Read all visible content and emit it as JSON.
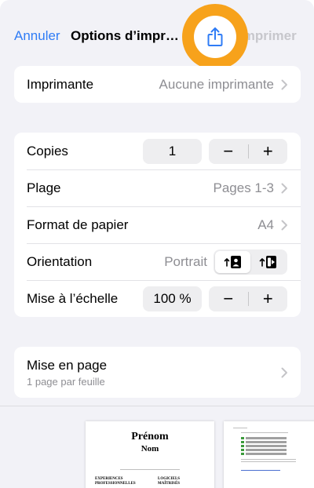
{
  "nav": {
    "cancel": "Annuler",
    "title": "Options d’impr…",
    "print": "Imprimer",
    "share_icon": "share-icon"
  },
  "printer": {
    "label": "Imprimante",
    "value": "Aucune imprimante"
  },
  "settings": {
    "copies": {
      "label": "Copies",
      "value": "1",
      "minus": "−",
      "plus": "+"
    },
    "range": {
      "label": "Plage",
      "value": "Pages 1-3"
    },
    "paper": {
      "label": "Format de papier",
      "value": "A4"
    },
    "orientation": {
      "label": "Orientation",
      "value": "Portrait",
      "options": [
        "portrait-icon",
        "landscape-icon"
      ],
      "selected": "portrait-icon"
    },
    "scale": {
      "label": "Mise à l’échelle",
      "value": "100 %",
      "minus": "−",
      "plus": "+"
    }
  },
  "layout": {
    "label": "Mise en page",
    "sub": "1 page par feuille"
  },
  "preview": {
    "page1": {
      "first_name": "Prénom",
      "last_name": "Nom",
      "col1": "EXPERIENCES PROFESSIONNELLES",
      "col2": "LOGICIELS MAÎTRISÉS"
    }
  },
  "colors": {
    "accent": "#2f7cf6",
    "highlight": "#f7a21b",
    "disabled": "#c7c7cc",
    "secondary": "#8e8e93"
  }
}
